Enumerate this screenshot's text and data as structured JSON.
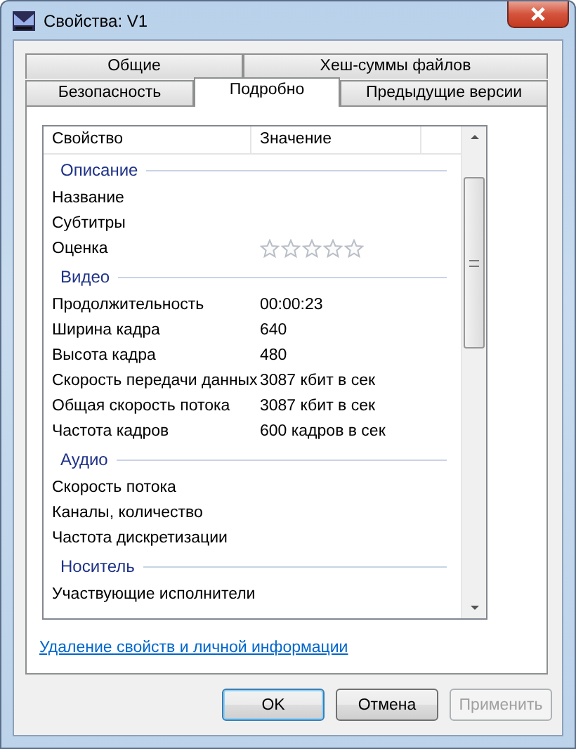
{
  "window": {
    "title": "Свойства: V1"
  },
  "tab_rows": [
    [
      {
        "label": "Общие",
        "selected": false
      },
      {
        "label": "Хеш-суммы файлов",
        "selected": false
      }
    ],
    [
      {
        "label": "Безопасность",
        "selected": false
      },
      {
        "label": "Подробно",
        "selected": true
      },
      {
        "label": "Предыдущие версии",
        "selected": false
      }
    ]
  ],
  "table": {
    "columns": [
      "Свойство",
      "Значение"
    ],
    "groups": [
      {
        "title": "Описание",
        "rows": [
          {
            "kind": "text",
            "name": "Название"
          },
          {
            "kind": "text",
            "name": "Субтитры"
          },
          {
            "kind": "stars",
            "name": "Оценка",
            "stars": 0
          }
        ]
      },
      {
        "title": "Видео",
        "rows": [
          {
            "kind": "text",
            "name": "Продолжительность",
            "value": "00:00:23"
          },
          {
            "kind": "text",
            "name": "Ширина кадра",
            "value": "640"
          },
          {
            "kind": "text",
            "name": "Высота кадра",
            "value": "480"
          },
          {
            "kind": "text",
            "name": "Скорость передачи данных",
            "value": "3087 кбит в сек"
          },
          {
            "kind": "text",
            "name": "Общая скорость потока",
            "value": "3087 кбит в сек"
          },
          {
            "kind": "text",
            "name": "Частота кадров",
            "value": "600 кадров в сек"
          }
        ]
      },
      {
        "title": "Аудио",
        "rows": [
          {
            "kind": "text",
            "name": "Скорость потока"
          },
          {
            "kind": "text",
            "name": "Каналы, количество"
          },
          {
            "kind": "text",
            "name": "Частота дискретизации"
          }
        ]
      },
      {
        "title": "Носитель",
        "rows": [
          {
            "kind": "text",
            "name": "Участвующие исполнители"
          }
        ]
      }
    ]
  },
  "link": "Удаление свойств и личной информации",
  "buttons": [
    {
      "label": "OK",
      "default": true,
      "disabled": false
    },
    {
      "label": "Отмена",
      "default": false,
      "disabled": false
    },
    {
      "label": "Применить",
      "default": false,
      "disabled": true
    }
  ]
}
